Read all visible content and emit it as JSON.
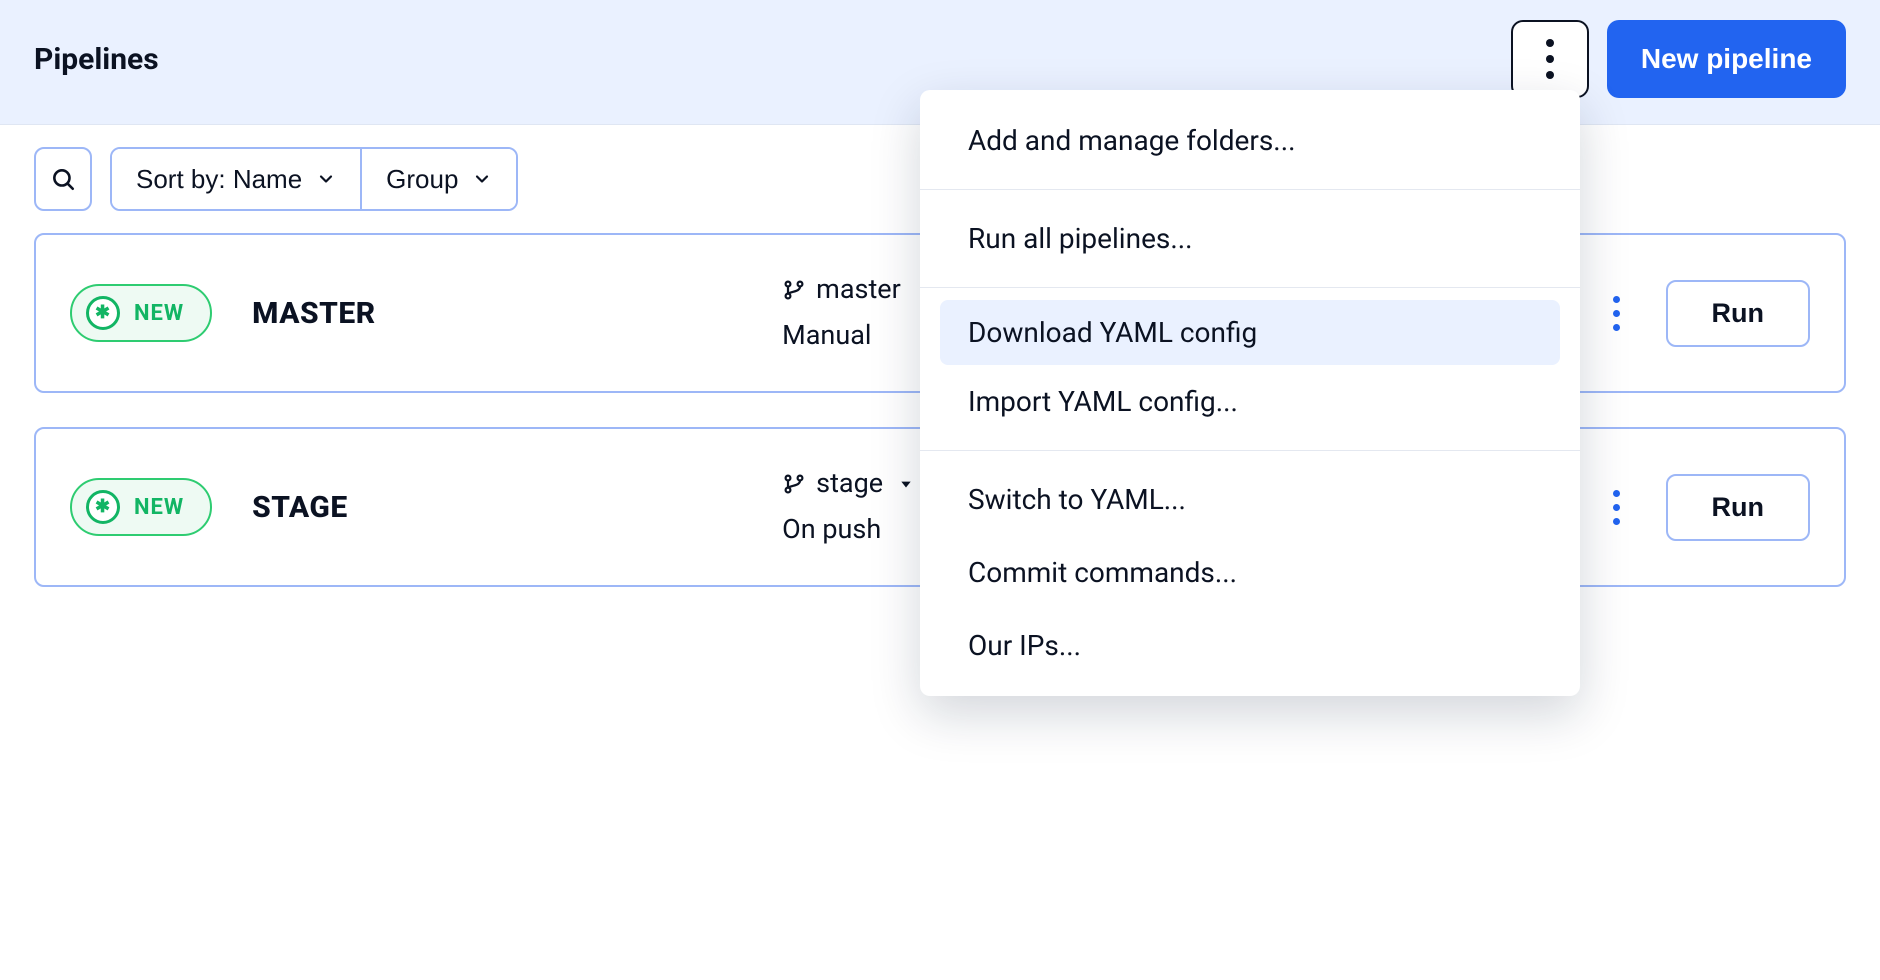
{
  "header": {
    "title": "Pipelines",
    "new_pipeline_label": "New pipeline"
  },
  "toolbar": {
    "sort_label": "Sort by: Name",
    "group_label": "Group"
  },
  "pipelines": [
    {
      "badge": "NEW",
      "name": "MASTER",
      "branch": "master",
      "has_caret": false,
      "trigger": "Manual",
      "run_label": "Run"
    },
    {
      "badge": "NEW",
      "name": "STAGE",
      "branch": "stage",
      "has_caret": true,
      "trigger": "On push",
      "run_label": "Run"
    }
  ],
  "menu": {
    "items": [
      {
        "label": "Add and manage folders...",
        "highlight": false,
        "divider_after": true
      },
      {
        "label": "Run all pipelines...",
        "highlight": false,
        "divider_after": true
      },
      {
        "label": "Download YAML config",
        "highlight": true,
        "divider_after": false
      },
      {
        "label": "Import YAML config...",
        "highlight": false,
        "divider_after": true
      },
      {
        "label": "Switch to YAML...",
        "highlight": false,
        "divider_after": false
      },
      {
        "label": "Commit commands...",
        "highlight": false,
        "divider_after": false
      },
      {
        "label": "Our IPs...",
        "highlight": false,
        "divider_after": false
      }
    ]
  }
}
